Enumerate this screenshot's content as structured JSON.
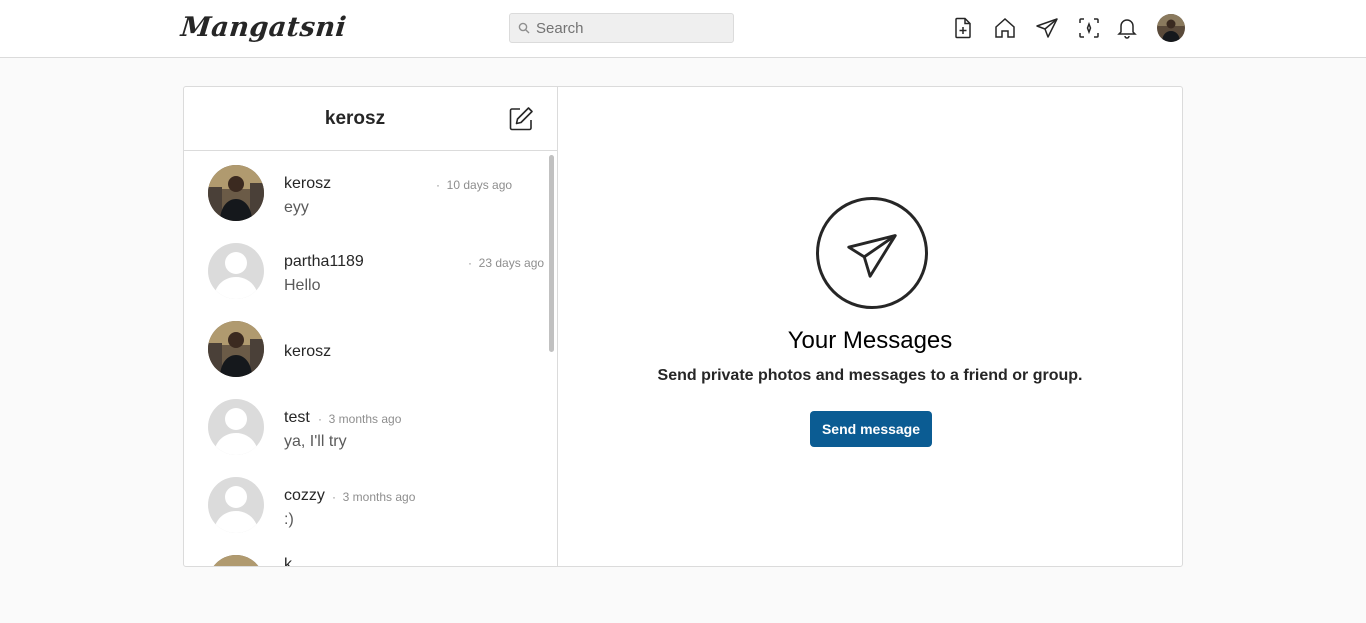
{
  "header": {
    "logo": "Mangatsni",
    "search_placeholder": "Search",
    "icons": [
      "new-post-icon",
      "home-icon",
      "direct-icon",
      "explore-icon",
      "notifications-icon",
      "profile-avatar"
    ]
  },
  "inbox": {
    "title": "kerosz",
    "conversations": [
      {
        "name": "kerosz",
        "time": "10 days ago",
        "message": "eyy",
        "avatar": "photo"
      },
      {
        "name": "partha1189",
        "time": "23 days ago",
        "message": "Hello",
        "avatar": "default"
      },
      {
        "name": "kerosz",
        "time": "",
        "message": "",
        "avatar": "photo"
      },
      {
        "name": "test",
        "time": "3 months ago",
        "message": "ya, I'll try",
        "avatar": "default"
      },
      {
        "name": "cozzy",
        "time": "3 months ago",
        "message": ":)",
        "avatar": "default"
      },
      {
        "name": "k",
        "time": "",
        "message": "",
        "avatar": "photo"
      }
    ]
  },
  "empty_state": {
    "title": "Your Messages",
    "subtitle": "Send private photos and messages to a friend or group.",
    "button_label": "Send message"
  },
  "colors": {
    "accent": "#0b5c93",
    "border": "#dbdbdb",
    "background": "#fafafa"
  }
}
